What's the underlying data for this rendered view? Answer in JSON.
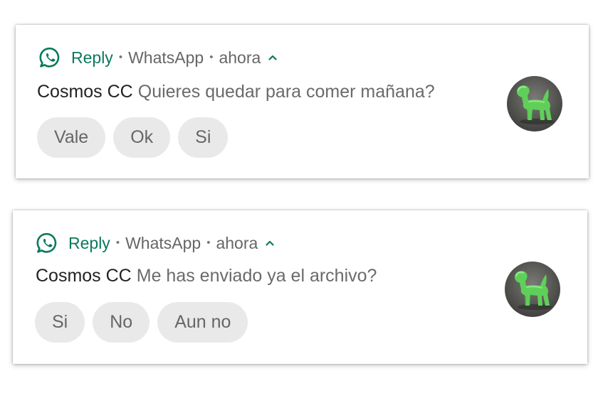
{
  "colors": {
    "app_accent": "#0b7a5c",
    "chip_background": "#e9e9e9",
    "avatar_background": "#4a4a4a",
    "avatar_toy": "#5fcf5a"
  },
  "notifications": [
    {
      "app_icon": "whatsapp-icon",
      "app_name": "Reply",
      "separator": "•",
      "source": "WhatsApp",
      "time": "ahora",
      "expand_icon": "chevron-up-icon",
      "sender": "Cosmos CC",
      "message": "Quieres quedar para comer mañana?",
      "actions": [
        "Vale",
        "Ok",
        "Si"
      ],
      "avatar_icon": "green-toy-dog-avatar"
    },
    {
      "app_icon": "whatsapp-icon",
      "app_name": "Reply",
      "separator": "•",
      "source": "WhatsApp",
      "time": "ahora",
      "expand_icon": "chevron-up-icon",
      "sender": "Cosmos CC",
      "message": "Me has enviado ya el archivo?",
      "actions": [
        "Si",
        "No",
        "Aun no"
      ],
      "avatar_icon": "green-toy-dog-avatar"
    }
  ]
}
